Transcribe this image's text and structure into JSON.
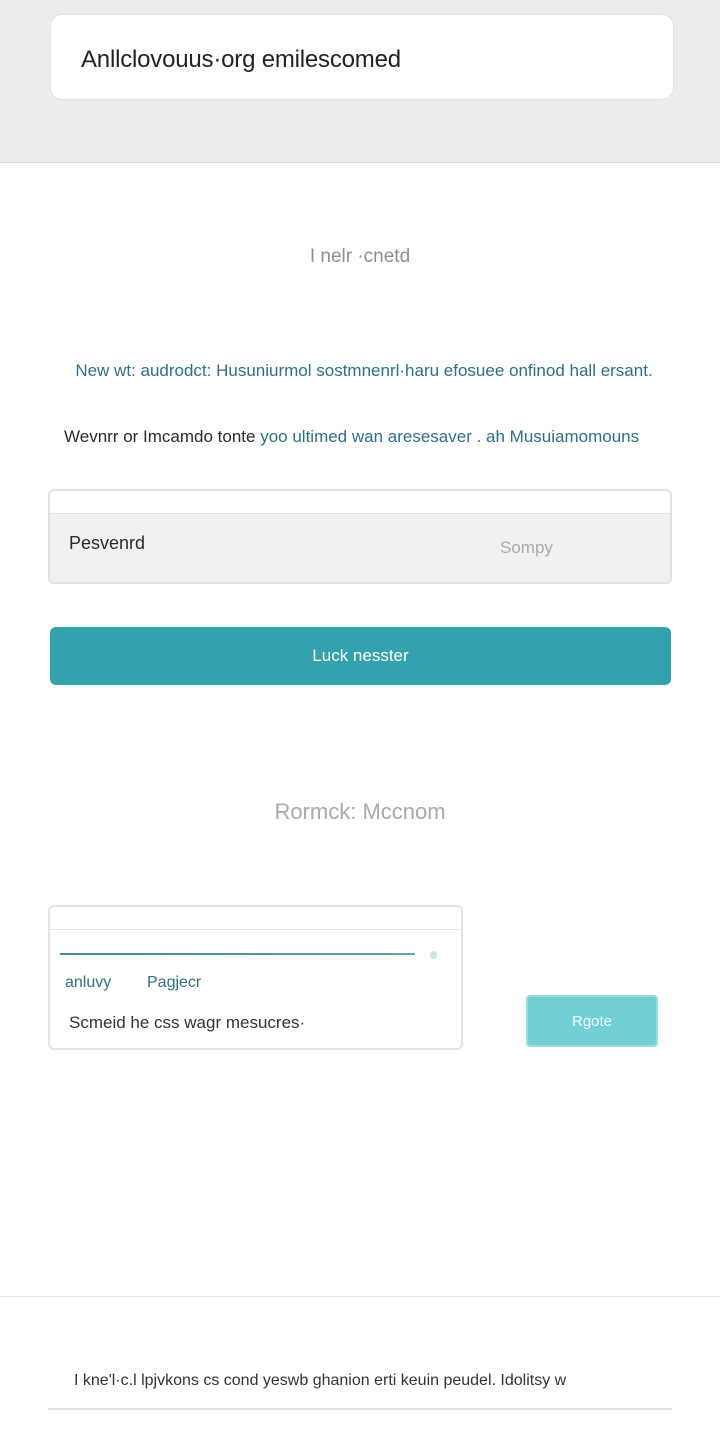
{
  "header": {
    "address": "Anllclovouus·org emilescomed"
  },
  "intro": {
    "heading": "I nelr ·cnetd",
    "line1": "New wt: audrodct: Husuniurmol sostmnenrl·haru efosuee onfinod hall ersant.",
    "line2_prefix": "Wevnrr or Imcamdo tonte ",
    "line2_accent": "yoo ultimed wan aresesaver . ah Musuiamomouns"
  },
  "password_field": {
    "label": "Pesvenrd",
    "placeholder": "Sompy"
  },
  "primary_button": {
    "label": "Luck nesster"
  },
  "section2": {
    "heading": "Rormck: Mccnom"
  },
  "card": {
    "meta_left": "anluvy",
    "meta_right": "Pagjecr",
    "message": "Scmeid he css wagr mesucres·"
  },
  "secondary_button": {
    "label": "Rgote"
  },
  "footer": {
    "text": "I kne'l·c.l lpjvkons cs cond yeswb ghanion erti keuin peudel. Idolitsy w"
  },
  "colors": {
    "accent": "#33a2ac",
    "accent_light": "#72cfd6",
    "link_text": "#2f6f85"
  }
}
